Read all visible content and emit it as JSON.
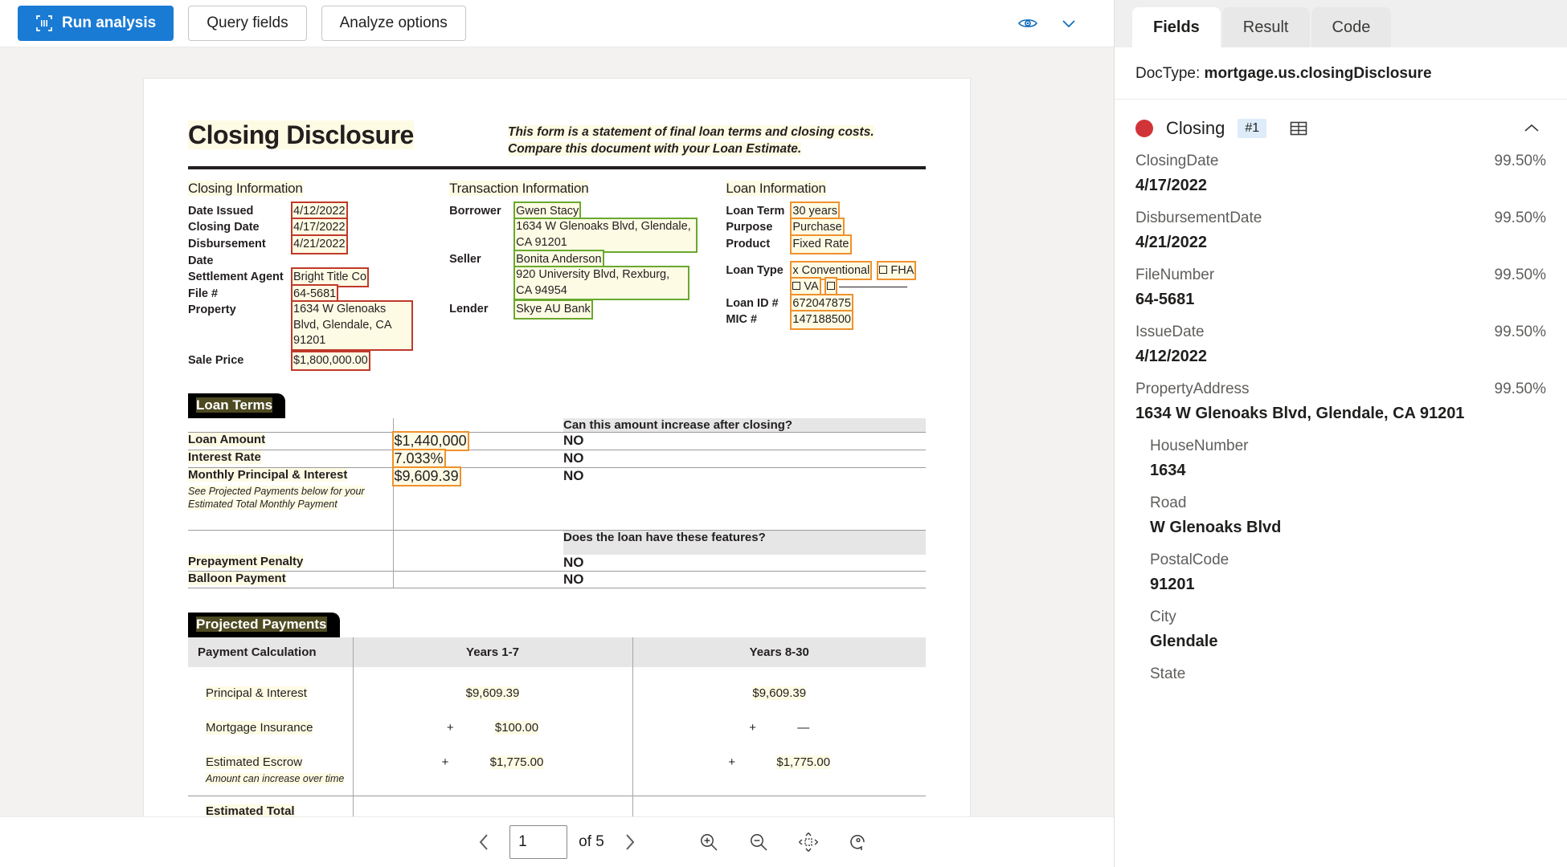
{
  "toolbar": {
    "run_analysis": "Run analysis",
    "query_fields": "Query fields",
    "analyze_options": "Analyze options",
    "eye_icon": "eye-icon",
    "chevron_icon": "chevron-down-icon"
  },
  "pager": {
    "prev": "‹",
    "next": "›",
    "page_value": "1",
    "of_label": "of 5",
    "zoom_in": "zoom-in-icon",
    "zoom_out": "zoom-out-icon",
    "fit_page": "fit-page-icon",
    "rotate": "rotate-icon"
  },
  "panel": {
    "tabs": [
      {
        "label": "Fields",
        "active": true
      },
      {
        "label": "Result",
        "active": false
      },
      {
        "label": "Code",
        "active": false
      }
    ],
    "doctype_label": "DocType:",
    "doctype_value": "mortgage.us.closingDisclosure",
    "group": {
      "name": "Closing",
      "badge": "#1",
      "dot_color": "#d13438",
      "table_icon": "table-icon",
      "collapse_icon": "chevron-up-icon"
    },
    "fields": [
      {
        "label": "ClosingDate",
        "confidence": "99.50%",
        "value": "4/17/2022",
        "nested": false
      },
      {
        "label": "DisbursementDate",
        "confidence": "99.50%",
        "value": "4/21/2022",
        "nested": false
      },
      {
        "label": "FileNumber",
        "confidence": "99.50%",
        "value": "64-5681",
        "nested": false
      },
      {
        "label": "IssueDate",
        "confidence": "99.50%",
        "value": "4/12/2022",
        "nested": false
      },
      {
        "label": "PropertyAddress",
        "confidence": "99.50%",
        "value": "1634 W Glenoaks Blvd, Glendale, CA 91201",
        "nested": false
      },
      {
        "label": "HouseNumber",
        "confidence": "",
        "value": "1634",
        "nested": true
      },
      {
        "label": "Road",
        "confidence": "",
        "value": "W Glenoaks Blvd",
        "nested": true
      },
      {
        "label": "PostalCode",
        "confidence": "",
        "value": "91201",
        "nested": true
      },
      {
        "label": "City",
        "confidence": "",
        "value": "Glendale",
        "nested": true
      },
      {
        "label": "State",
        "confidence": "",
        "value": "",
        "nested": true
      }
    ]
  },
  "document": {
    "title": "Closing Disclosure",
    "blurb": "This form is a statement of final loan terms and closing costs. Compare this document with your Loan Estimate.",
    "closing_information": {
      "heading": "Closing Information",
      "rows": [
        {
          "label": "Date Issued",
          "value": "4/12/2022",
          "box": "red"
        },
        {
          "label": "Closing Date",
          "value": "4/17/2022",
          "box": "red"
        },
        {
          "label": "Disbursement Date",
          "value": "4/21/2022",
          "box": "red"
        },
        {
          "label": "Settlement Agent",
          "value": "Bright  Title Co",
          "box": "red"
        },
        {
          "label": "File #",
          "value": "64-5681",
          "box": "red"
        },
        {
          "label": "Property",
          "value": "1634 W Glenoaks Blvd, Glendale, CA 91201",
          "box": "red"
        },
        {
          "label": "Sale Price",
          "value": "$1,800,000.00",
          "box": "red"
        }
      ]
    },
    "transaction_information": {
      "heading": "Transaction Information",
      "rows": [
        {
          "label": "Borrower",
          "value": "Gwen Stacy",
          "box": "green"
        },
        {
          "label": "",
          "value": "1634 W Glenoaks Blvd, Glendale, CA 91201",
          "box": "green"
        },
        {
          "label": "Seller",
          "value": "Bonita Anderson",
          "box": "green"
        },
        {
          "label": "",
          "value": "920 University Blvd, Rexburg, CA 94954",
          "box": "green"
        },
        {
          "label": "Lender",
          "value": "Skye AU Bank",
          "box": "green"
        }
      ]
    },
    "loan_information": {
      "heading": "Loan Information",
      "rows": [
        {
          "label": "Loan Term",
          "value": "30 years",
          "box": "orange"
        },
        {
          "label": "Purpose",
          "value": "Purchase",
          "box": "orange"
        },
        {
          "label": "Product",
          "value": "Fixed Rate",
          "box": "orange"
        }
      ],
      "loan_type_label": "Loan Type",
      "loan_type_options": [
        {
          "mark": "x",
          "label": "Conventional"
        },
        {
          "mark": "",
          "label": "FHA"
        },
        {
          "mark": "",
          "label": "VA"
        },
        {
          "mark": "",
          "label": ""
        }
      ],
      "loan_id_label": "Loan ID #",
      "loan_id_value": "672047875",
      "mic_label": "MIC #",
      "mic_value": "147188500"
    },
    "loan_terms": {
      "section_title": "Loan Terms",
      "col_header_increase": "Can this amount increase after closing?",
      "col_header_features": "Does the loan have these features?",
      "rows": [
        {
          "name": "Loan Amount",
          "sub": "",
          "amount": "$1,440,000",
          "answer": "NO",
          "box": "orange"
        },
        {
          "name": "Interest Rate",
          "sub": "",
          "amount": "7.033%",
          "answer": "NO",
          "box": "orange"
        },
        {
          "name": "Monthly Principal & Interest",
          "sub": "See Projected Payments below for your Estimated Total Monthly Payment",
          "amount": "$9,609.39",
          "answer": "NO",
          "box": "orange"
        }
      ],
      "feature_rows": [
        {
          "name": "Prepayment Penalty",
          "answer": "NO"
        },
        {
          "name": "Balloon Payment",
          "answer": "NO"
        }
      ]
    },
    "projected_payments": {
      "section_title": "Projected Payments",
      "headers": [
        "Payment Calculation",
        "Years 1-7",
        "Years 8-30"
      ],
      "rows": [
        {
          "name": "Principal & Interest",
          "sub": "",
          "y1": "$9,609.39",
          "y1_plus": "",
          "y2": "$9,609.39",
          "y2_plus": ""
        },
        {
          "name": "Mortgage Insurance",
          "sub": "",
          "y1": "$100.00",
          "y1_plus": "+",
          "y2": "—",
          "y2_plus": "+"
        },
        {
          "name": "Estimated Escrow",
          "sub": "Amount can increase over time",
          "y1": "$1,775.00",
          "y1_plus": "+",
          "y2": "$1,775.00",
          "y2_plus": "+"
        }
      ],
      "total_row_name": "Estimated Total"
    }
  }
}
